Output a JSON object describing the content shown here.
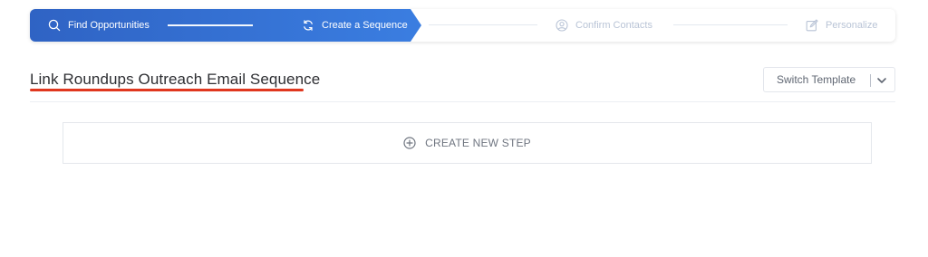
{
  "stepper": {
    "steps": [
      {
        "label": "Find Opportunities",
        "icon": "search-icon",
        "state": "done"
      },
      {
        "label": "Create a Sequence",
        "icon": "refresh-icon",
        "state": "current"
      },
      {
        "label": "Confirm Contacts",
        "icon": "user-circle-icon",
        "state": "pending"
      },
      {
        "label": "Personalize",
        "icon": "edit-icon",
        "state": "pending"
      }
    ],
    "active_color": "#2f63c4",
    "pending_color": "#b9c4d6"
  },
  "header": {
    "title": "Link Roundups Outreach Email Sequence",
    "underline_color": "#e0371f",
    "switch_template_label": "Switch Template"
  },
  "main": {
    "create_step_label": "CREATE NEW STEP",
    "create_step_icon": "plus-circle-icon"
  }
}
